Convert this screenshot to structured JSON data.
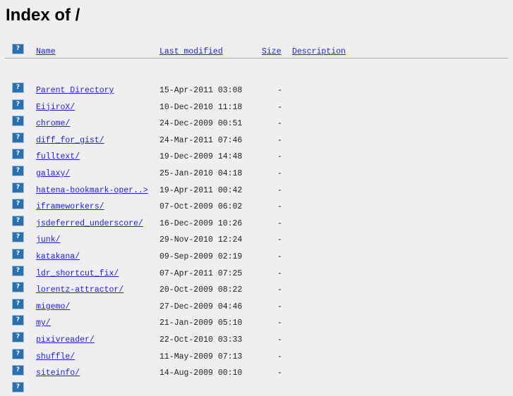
{
  "title": "Index of /",
  "header": {
    "name": "Name",
    "last_modified": "Last modified",
    "size": "Size",
    "description": "Description"
  },
  "rows": [
    {
      "name": "Parent Directory",
      "date": "15-Apr-2011 03:08",
      "size": "-"
    },
    {
      "name": "EijiroX/",
      "date": "10-Dec-2010 11:18",
      "size": "-"
    },
    {
      "name": "chrome/",
      "date": "24-Dec-2009 00:51",
      "size": "-"
    },
    {
      "name": "diff_for_gist/",
      "date": "24-Mar-2011 07:46",
      "size": "-"
    },
    {
      "name": "fulltext/",
      "date": "19-Dec-2009 14:48",
      "size": "-"
    },
    {
      "name": "galaxy/",
      "date": "25-Jan-2010 04:18",
      "size": "-"
    },
    {
      "name": "hatena-bookmark-oper..>",
      "date": "19-Apr-2011 00:42",
      "size": "-"
    },
    {
      "name": "iframeworkers/",
      "date": "07-Oct-2009 06:02",
      "size": "-"
    },
    {
      "name": "jsdeferred_underscore/",
      "date": "16-Dec-2009 10:26",
      "size": "-"
    },
    {
      "name": "junk/",
      "date": "29-Nov-2010 12:24",
      "size": "-"
    },
    {
      "name": "katakana/",
      "date": "09-Sep-2009 02:19",
      "size": "-"
    },
    {
      "name": "ldr_shortcut_fix/",
      "date": "07-Apr-2011 07:25",
      "size": "-"
    },
    {
      "name": "lorentz-attractor/",
      "date": "20-Oct-2009 08:22",
      "size": "-"
    },
    {
      "name": "migemo/",
      "date": "27-Dec-2009 04:46",
      "size": "-"
    },
    {
      "name": "my/",
      "date": "21-Jan-2009 05:10",
      "size": "-"
    },
    {
      "name": "pixivreader/",
      "date": "22-Oct-2010 03:33",
      "size": "-"
    },
    {
      "name": "shuffle/",
      "date": "11-May-2009 07:13",
      "size": "-"
    },
    {
      "name": "siteinfo/",
      "date": "14-Aug-2009 00:10",
      "size": "-"
    }
  ],
  "icon": "unknown-file-icon",
  "icon_glyph": "?"
}
